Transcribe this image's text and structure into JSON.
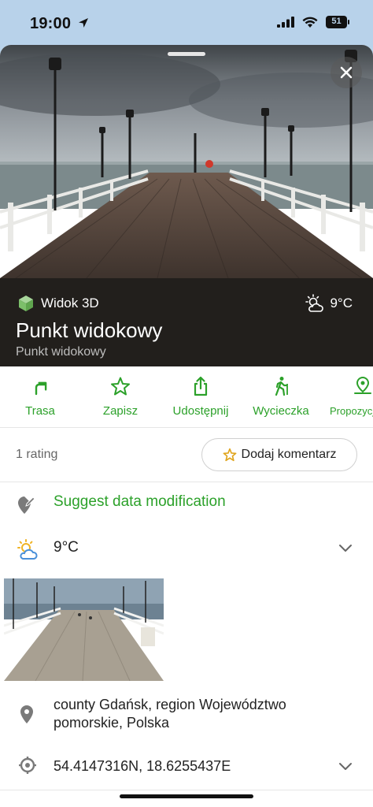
{
  "status_bar": {
    "time": "19:00",
    "battery": "51"
  },
  "header": {
    "badge_3d": "Widok 3D",
    "weather": "9°C",
    "title": "Punkt widokowy",
    "subtitle": "Punkt widokowy"
  },
  "actions": [
    {
      "label": "Trasa",
      "icon": "route-icon"
    },
    {
      "label": "Zapisz",
      "icon": "star-icon"
    },
    {
      "label": "Udostępnij",
      "icon": "share-icon"
    },
    {
      "label": "Wycieczka",
      "icon": "hiker-icon"
    },
    {
      "label": "Propozycje",
      "icon": "pin-icon"
    }
  ],
  "rating": {
    "text": "1 rating",
    "comment_button": "Dodaj komentarz"
  },
  "suggest": {
    "label": "Suggest data modification"
  },
  "weather_row": {
    "label": "9°C"
  },
  "location": {
    "address": "county Gdańsk, region Województwo pomorskie, Polska",
    "coordinates": "54.4147316N, 18.6255437E"
  },
  "colors": {
    "accent": "#2ca12a",
    "panel": "#221f1c",
    "status_bar": "#b8d2ea"
  }
}
